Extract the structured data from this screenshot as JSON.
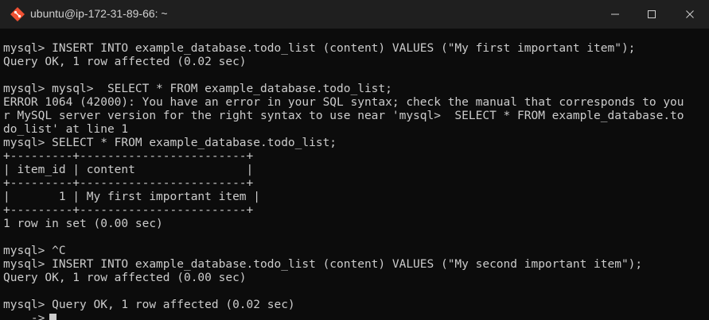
{
  "window": {
    "title": "ubuntu@ip-172-31-89-66: ~",
    "icon": "git-bash-icon",
    "controls": [
      "minimize-icon",
      "maximize-icon",
      "close-icon"
    ]
  },
  "terminal": {
    "lines": [
      "mysql> INSERT INTO example_database.todo_list (content) VALUES (\"My first important item\");",
      "Query OK, 1 row affected (0.02 sec)",
      "",
      "mysql> mysql>  SELECT * FROM example_database.todo_list;",
      "ERROR 1064 (42000): You have an error in your SQL syntax; check the manual that corresponds to you",
      "r MySQL server version for the right syntax to use near 'mysql>  SELECT * FROM example_database.to",
      "do_list' at line 1",
      "mysql> SELECT * FROM example_database.todo_list;",
      "+---------+------------------------+",
      "| item_id | content                |",
      "+---------+------------------------+",
      "|       1 | My first important item |",
      "+---------+------------------------+",
      "1 row in set (0.00 sec)",
      "",
      "mysql> ^C",
      "mysql> INSERT INTO example_database.todo_list (content) VALUES (\"My second important item\");",
      "Query OK, 1 row affected (0.00 sec)",
      "",
      "mysql> Query OK, 1 row affected (0.02 sec)",
      "    ->"
    ]
  }
}
